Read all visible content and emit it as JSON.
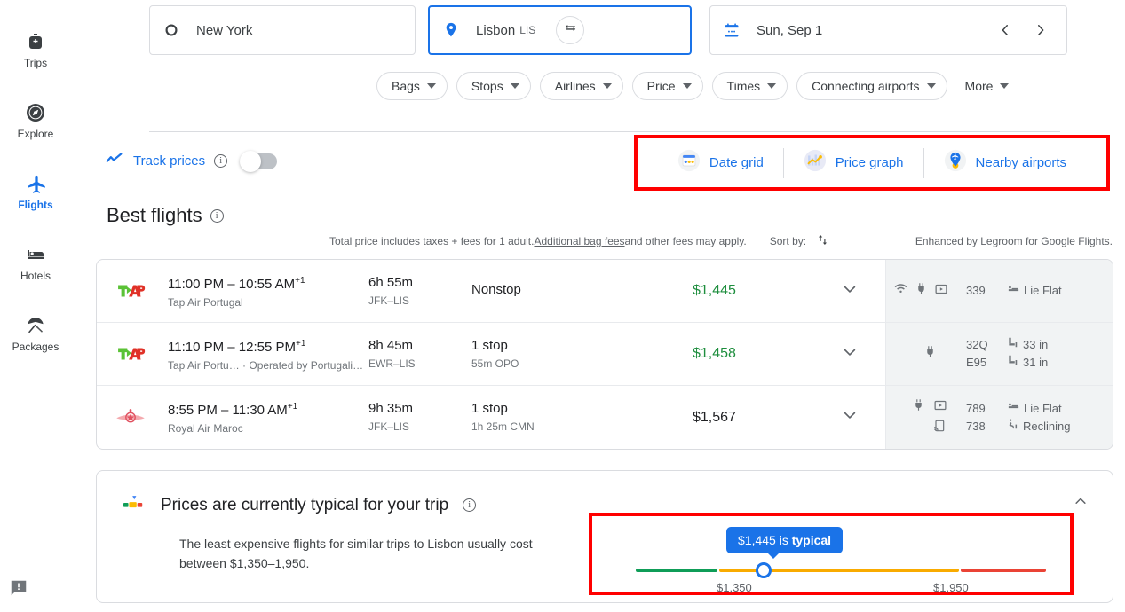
{
  "rail": {
    "items": [
      {
        "label": "Trips",
        "icon": "travel-bag-icon",
        "active": false
      },
      {
        "label": "Explore",
        "icon": "compass-icon",
        "active": false
      },
      {
        "label": "Flights",
        "icon": "airplane-icon",
        "active": true
      },
      {
        "label": "Hotels",
        "icon": "bed-icon",
        "active": false
      },
      {
        "label": "Packages",
        "icon": "beach-umbrella-icon",
        "active": false
      }
    ],
    "feedback": "feedback-icon"
  },
  "search": {
    "origin": {
      "value": "New York",
      "icon": "circle-origin-icon"
    },
    "destination": {
      "value": "Lisbon",
      "code": "LIS",
      "icon": "location-pin-icon"
    },
    "swap": "swap-icon",
    "date": {
      "value": "Sun, Sep 1",
      "icon": "calendar-icon",
      "prev": "‹",
      "next": "›"
    }
  },
  "filters": [
    {
      "label": "Bags"
    },
    {
      "label": "Stops"
    },
    {
      "label": "Airlines"
    },
    {
      "label": "Price"
    },
    {
      "label": "Times"
    },
    {
      "label": "Connecting airports"
    },
    {
      "label": "More"
    }
  ],
  "track_prices": {
    "label": "Track prices",
    "icon": "trending-line-icon",
    "enabled": false
  },
  "tools": {
    "highlight_color": "#ff0000",
    "items": [
      {
        "label": "Date grid",
        "icon": "date-grid-icon"
      },
      {
        "label": "Price graph",
        "icon": "price-graph-icon"
      },
      {
        "label": "Nearby airports",
        "icon": "nearby-airports-icon"
      }
    ]
  },
  "best_flights": {
    "title": "Best flights",
    "disclaimer_pre": "Total price includes taxes + fees for 1 adult. ",
    "disclaimer_link": "Additional bag fees",
    "disclaimer_post": " and other fees may apply.",
    "sort_by_label": "Sort by:",
    "sort_icon": "sort-arrows-icon",
    "legroom_note": "Enhanced by Legroom for Google Flights."
  },
  "flights": [
    {
      "logo": "tap-air-portugal-logo",
      "times": "11:00 PM – 10:55 AM",
      "day_offset": "+1",
      "airline": "Tap Air Portugal",
      "duration": "6h 55m",
      "route": "JFK–LIS",
      "stops": "Nonstop",
      "stop_detail": "",
      "price": "$1,445",
      "price_is_deal": true,
      "expand_icon": "chevron-down-icon",
      "amenities": {
        "icons": [
          "wifi-icon",
          "power-outlet-icon",
          "video-screen-icon"
        ],
        "codes": [
          "339"
        ],
        "seats": [
          {
            "icon": "lie-flat-seat-icon",
            "label": "Lie Flat"
          }
        ]
      }
    },
    {
      "logo": "tap-air-portugal-logo",
      "times": "11:10 PM – 12:55 PM",
      "day_offset": "+1",
      "airline": "Tap Air Portu…  ·  Operated by Portugalia Airli…",
      "duration": "8h 45m",
      "route": "EWR–LIS",
      "stops": "1 stop",
      "stop_detail": "55m OPO",
      "price": "$1,458",
      "price_is_deal": true,
      "expand_icon": "chevron-down-icon",
      "amenities": {
        "icons": [
          "power-outlet-icon"
        ],
        "codes": [
          "32Q",
          "E95"
        ],
        "seats": [
          {
            "icon": "legroom-icon",
            "label": "33 in"
          },
          {
            "icon": "legroom-icon",
            "label": "31 in"
          }
        ]
      }
    },
    {
      "logo": "royal-air-maroc-logo",
      "times": "8:55 PM – 11:30 AM",
      "day_offset": "+1",
      "airline": "Royal Air Maroc",
      "duration": "9h 35m",
      "route": "JFK–LIS",
      "stops": "1 stop",
      "stop_detail": "1h 25m CMN",
      "price": "$1,567",
      "price_is_deal": false,
      "expand_icon": "chevron-down-icon",
      "amenities": {
        "icons": [
          "power-outlet-icon",
          "video-screen-icon",
          "stream-to-device-icon"
        ],
        "codes": [
          "789",
          "738"
        ],
        "seats": [
          {
            "icon": "lie-flat-seat-icon",
            "label": "Lie Flat"
          },
          {
            "icon": "reclining-seat-icon",
            "label": "Reclining"
          }
        ]
      }
    }
  ],
  "price_insights": {
    "icon": "price-insights-icon",
    "title": "Prices are currently typical for your trip",
    "body": "The least expensive flights for similar trips to Lisbon usually cost between $1,350–1,950.",
    "collapse_icon": "chevron-up-icon",
    "highlight_color": "#ff0000",
    "gauge": {
      "bubble_prefix": "$1,445 is ",
      "bubble_emphasis": "typical",
      "low_label": "$1,350",
      "high_label": "$1,950",
      "low_color": "#0f9d58",
      "typical_color": "#f9ab00",
      "high_color": "#ea4335",
      "marker_value": 1445,
      "range_low": 1350,
      "range_high": 1950
    }
  }
}
